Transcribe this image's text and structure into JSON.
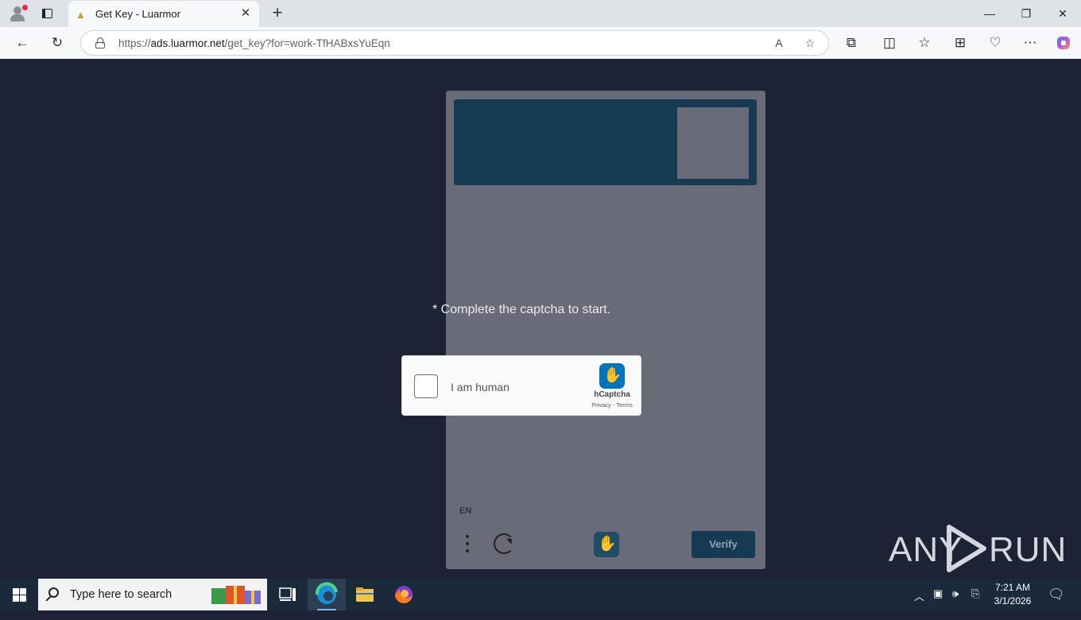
{
  "browser": {
    "tab_title": "Get Key - Luarmor",
    "url_prefix": "https://",
    "url_host": "ads.luarmor.net",
    "url_path": "/get_key?for=work-TfHABxsYuEqn"
  },
  "page": {
    "instruction": "* Complete the captcha to start.",
    "hcaptcha": {
      "checkbox_label": "I am human",
      "brand": "hCaptcha",
      "legal": "Privacy - Terms"
    },
    "challenge": {
      "language": "EN",
      "verify_label": "Verify"
    },
    "watermark": {
      "left": "ANY",
      "right": "RUN"
    }
  },
  "taskbar": {
    "search_placeholder": "Type here to search",
    "time": "7:21 AM",
    "date": "3/1/2026"
  },
  "colors": {
    "page_background": "#1e2235",
    "challenge_panel": "#696b78",
    "prompt_header": "#163a51",
    "hcaptcha_brand": "#0074bf"
  }
}
